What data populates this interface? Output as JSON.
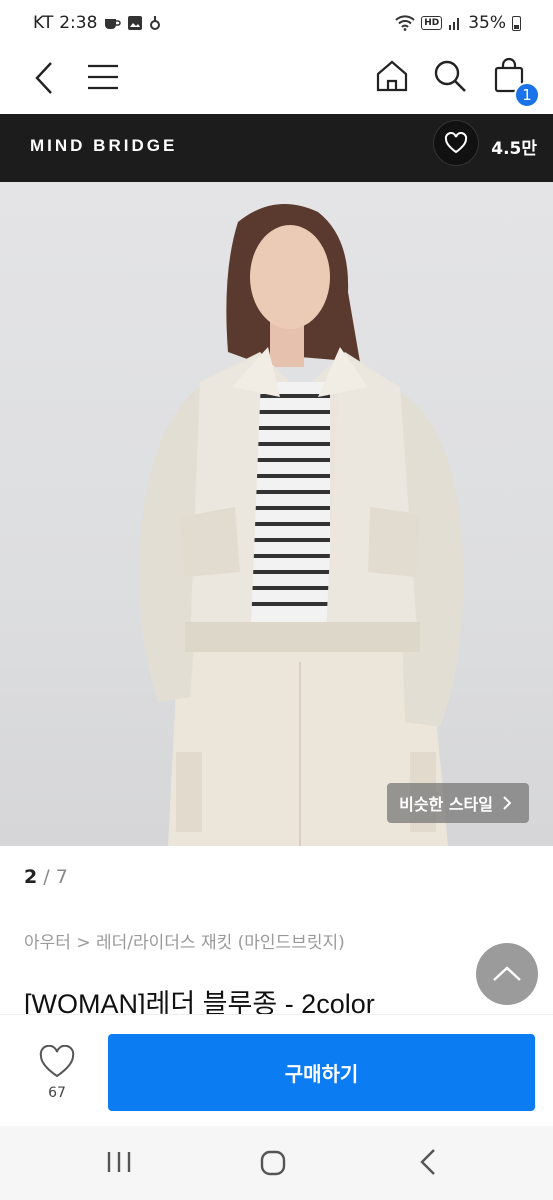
{
  "status_bar": {
    "carrier": "KT",
    "time": "2:38",
    "hd_label": "HD",
    "battery": "35%"
  },
  "nav": {
    "cart_count": "1"
  },
  "brand_bar": {
    "name": "MIND BRIDGE",
    "likes": "4.5만"
  },
  "product": {
    "similar_style_label": "비슷한 스타일",
    "image_index": "2",
    "image_sep": "/",
    "image_total": "7",
    "breadcrumb": "아우터 > 레더/라이더스 재킷 (마인드브릿지)",
    "title": "[WOMAN]레더 블루종 - 2color"
  },
  "buy_bar": {
    "like_count": "67",
    "buy_label": "구매하기"
  },
  "colors": {
    "accent": "#0b7cf2",
    "badge": "#1a73e8",
    "brand_bg": "#1c1c1c"
  }
}
